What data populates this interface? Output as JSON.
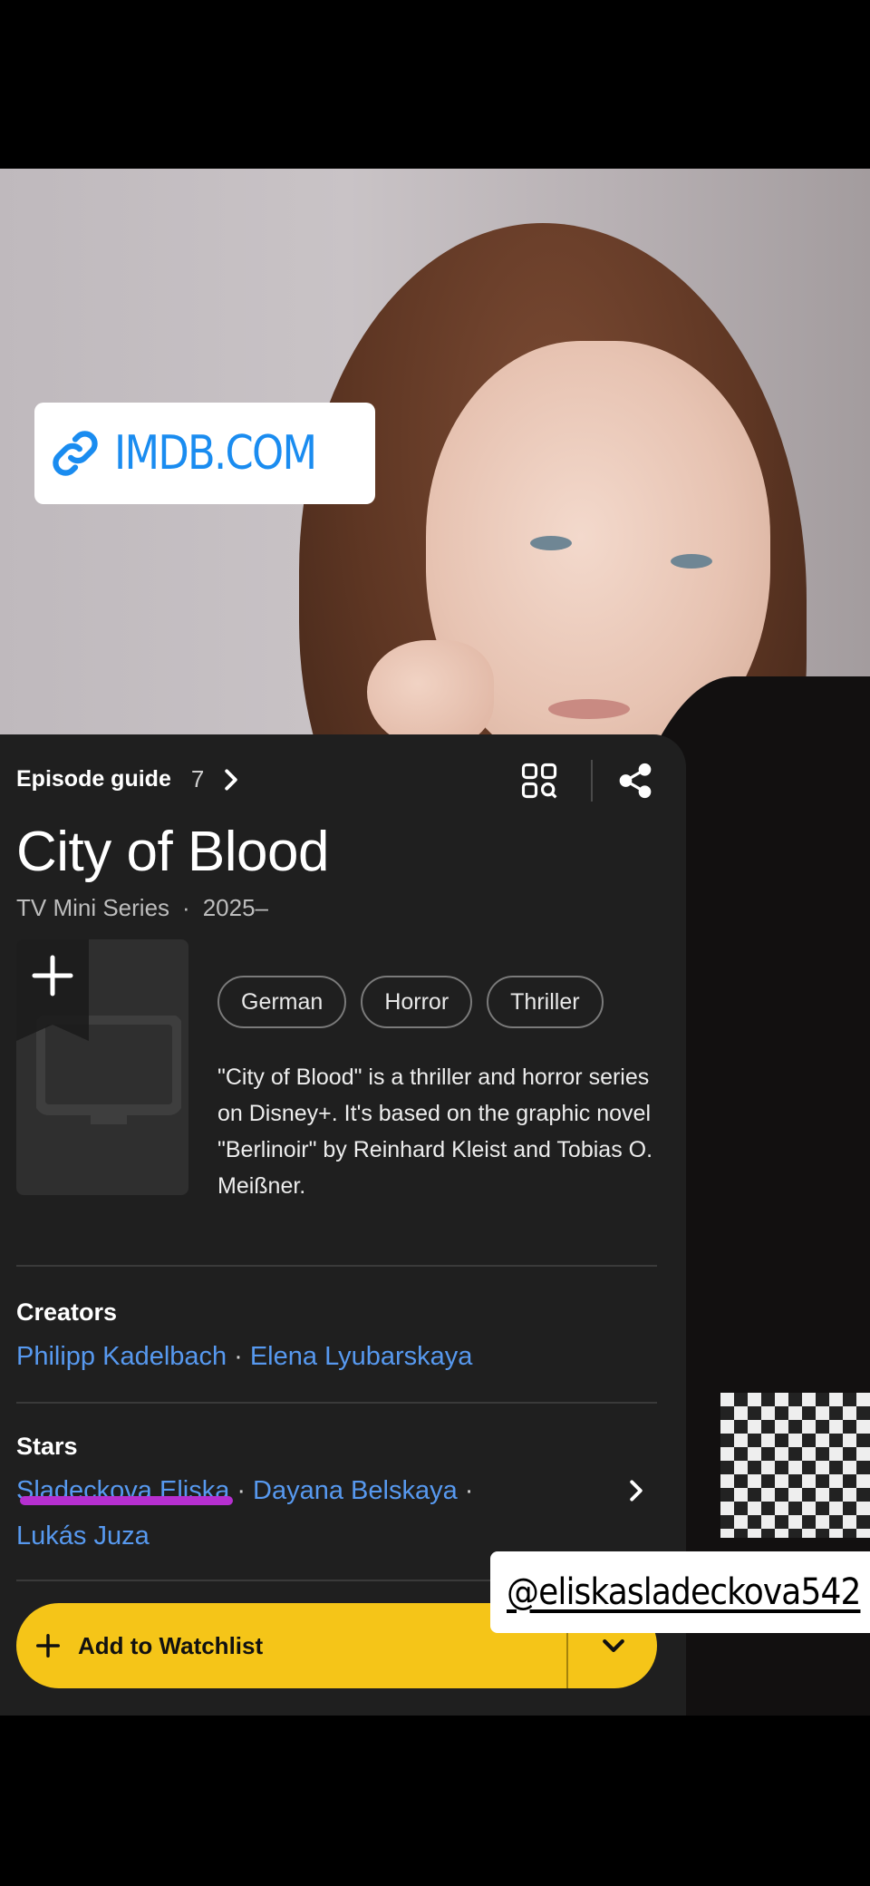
{
  "link_sticker": {
    "text": "IMDB.COM"
  },
  "card": {
    "episode_guide": {
      "label": "Episode guide",
      "count": "7"
    },
    "title": "City of Blood",
    "meta": {
      "type": "TV Mini Series",
      "separator": "·",
      "years": "2025–"
    },
    "genres": [
      "German",
      "Horror",
      "Thriller"
    ],
    "plot": {
      "part1": "\"City of Blood\" is a thriller and horror series",
      "highlight": " on Disney+",
      "part2": ". It's based on the graphic novel \"Berlinoir\" by Reinhard Kleist and Tobias O. Meißner."
    },
    "creators": {
      "label": "Creators",
      "names": [
        "Philipp Kadelbach",
        "Elena Lyubarskaya"
      ]
    },
    "stars": {
      "label": "Stars",
      "names": [
        "Sladeckova Eliska",
        "Dayana Belskaya",
        "Lukás Juza"
      ]
    },
    "watchlist_button": {
      "label": "Add to Watchlist"
    }
  },
  "user_sticker": {
    "text": "@eliskasladeckova542"
  },
  "colors": {
    "imdb_yellow": "#f5c518",
    "link_blue": "#5799ef",
    "highlight_purple": "#b62fd0",
    "card_bg": "#1f1f1f"
  }
}
